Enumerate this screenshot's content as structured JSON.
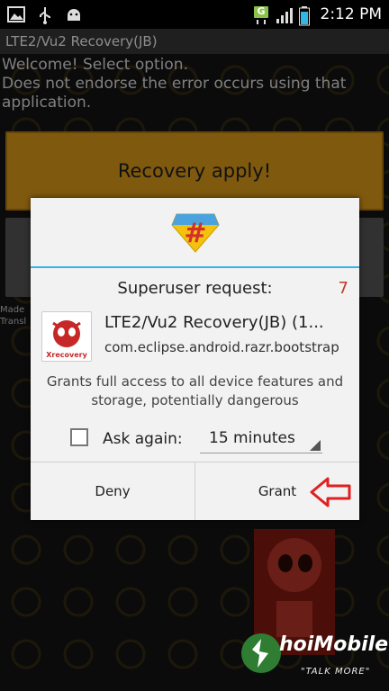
{
  "status_bar": {
    "time": "2:12 PM",
    "network_badge": "G",
    "left_icons": [
      "image-icon",
      "usb-icon",
      "android-debug-icon"
    ],
    "right_icons": [
      "data-network-icon",
      "signal-icon",
      "battery-icon"
    ]
  },
  "app": {
    "title": "LTE2/Vu2 Recovery(JB)",
    "welcome_line1": "Welcome! Select option.",
    "welcome_line2": "Does not endorse the error occurs using that application.",
    "primary_button_label": "Recovery apply!",
    "made_by_partial_1": "Made",
    "made_by_partial_2": "Transl"
  },
  "dialog": {
    "icon": "superuser-icon",
    "title": "Superuser request:",
    "countdown": "7",
    "app_icon_label": "Xrecovery",
    "app_name": "LTE2/Vu2 Recovery(JB) (1...",
    "package_name": "com.eclipse.android.razr.bootstrap",
    "description": "Grants full access to all device features and storage, potentially dangerous",
    "ask_again_label": "Ask again:",
    "ask_again_checked": false,
    "duration_value": "15 minutes",
    "deny_label": "Deny",
    "grant_label": "Grant"
  },
  "watermark": {
    "brand": "hoiMobile",
    "tagline": "\"TALK MORE\""
  },
  "colors": {
    "accent_divider": "#33b5e5",
    "countdown": "#c0392b",
    "primary_button": "#e8a21a",
    "annotation_arrow": "#e02020"
  }
}
